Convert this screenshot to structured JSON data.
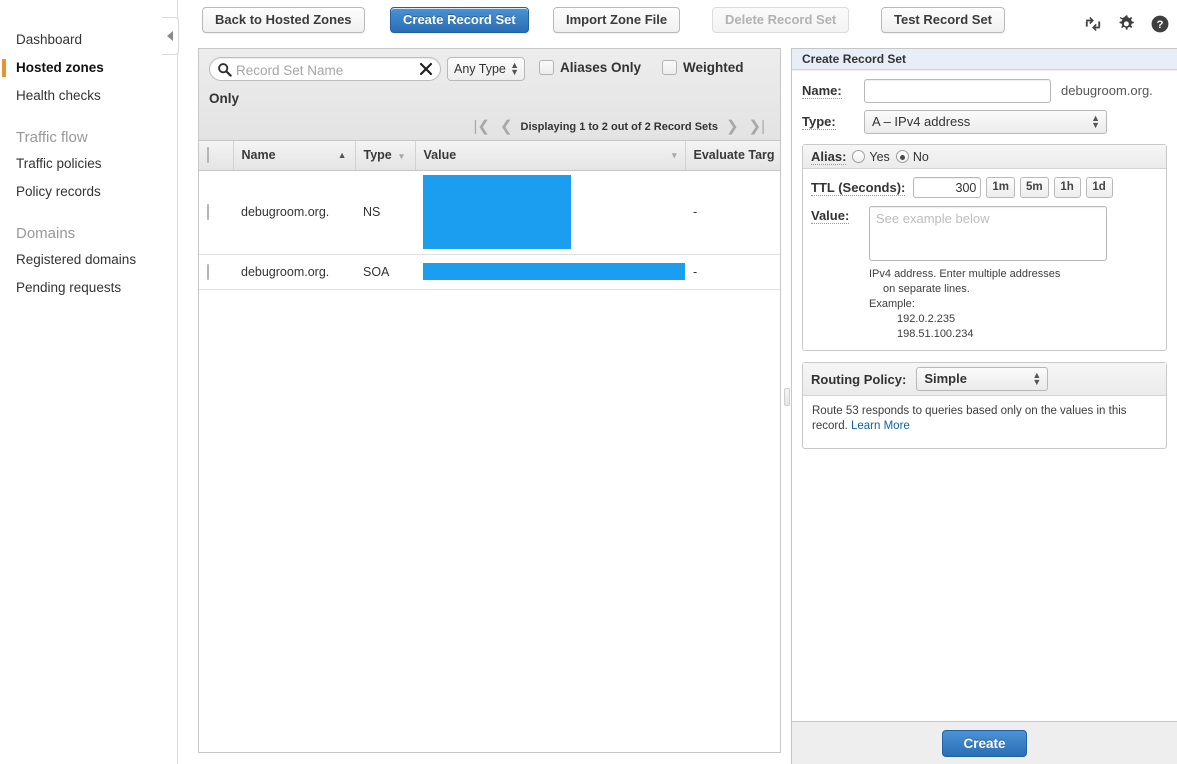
{
  "sidebar": {
    "items": [
      {
        "label": "Dashboard",
        "type": "item",
        "active": false
      },
      {
        "label": "Hosted zones",
        "type": "item",
        "active": true
      },
      {
        "label": "Health checks",
        "type": "item",
        "active": false
      },
      {
        "label": "Traffic flow",
        "type": "group"
      },
      {
        "label": "Traffic policies",
        "type": "item",
        "active": false
      },
      {
        "label": "Policy records",
        "type": "item",
        "active": false
      },
      {
        "label": "Domains",
        "type": "group"
      },
      {
        "label": "Registered domains",
        "type": "item",
        "active": false
      },
      {
        "label": "Pending requests",
        "type": "item",
        "active": false
      }
    ],
    "collapse_icon": "chevron-left-icon",
    "active_marker_color": "#ec912d"
  },
  "toolbar": {
    "back_label": "Back to Hosted Zones",
    "create_record_set_label": "Create Record Set",
    "import_zone_file_label": "Import Zone File",
    "delete_record_set_label": "Delete Record Set",
    "delete_disabled": true,
    "test_record_set_label": "Test Record Set",
    "primary_color": "#2a6eb5",
    "icons": [
      "refresh-icon",
      "gear-icon",
      "help-icon"
    ]
  },
  "filters": {
    "search_placeholder": "Record Set Name",
    "search_value": "",
    "search_icon": "search-icon",
    "clear_icon": "close-icon",
    "type_filter_value": "Any Type",
    "aliases_only_label": "Aliases Only",
    "aliases_only_checked": false,
    "weighted_label": "Weighted",
    "weighted_only_wrap_label": "Only",
    "weighted_checked": false
  },
  "pagination": {
    "first_icon": "first-page-icon",
    "prev_icon": "prev-page-icon",
    "text": "Displaying 1 to 2 out of 2 Record Sets",
    "next_icon": "next-page-icon",
    "last_icon": "last-page-icon"
  },
  "table": {
    "columns": [
      {
        "label": "",
        "key": "check"
      },
      {
        "label": "Name",
        "key": "name",
        "sort": "asc"
      },
      {
        "label": "Type",
        "key": "type",
        "sort": "none"
      },
      {
        "label": "Value",
        "key": "value",
        "sort": "none"
      },
      {
        "label": "Evaluate Targ",
        "key": "evaluate"
      }
    ],
    "rows": [
      {
        "name": "debugroom.org.",
        "type": "NS",
        "value": "",
        "value_redacted": true,
        "evaluate": "-"
      },
      {
        "name": "debugroom.org.",
        "type": "SOA",
        "value": "",
        "value_redacted": true,
        "evaluate": "-"
      }
    ],
    "redaction_color": "#1b9df0"
  },
  "right_panel": {
    "title": "Create Record Set",
    "name_label": "Name:",
    "name_value": "",
    "name_suffix": "debugroom.org.",
    "type_label": "Type:",
    "type_value": "A – IPv4 address",
    "alias_label": "Alias:",
    "alias_yes_label": "Yes",
    "alias_no_label": "No",
    "alias_selected": "No",
    "ttl_label": "TTL (Seconds):",
    "ttl_value": "300",
    "ttl_buttons": [
      "1m",
      "5m",
      "1h",
      "1d"
    ],
    "value_label": "Value:",
    "value_placeholder": "See example below",
    "value_text": "",
    "value_help_line1": "IPv4 address. Enter multiple addresses",
    "value_help_line2": "on separate lines.",
    "value_help_line3": "Example:",
    "value_help_example1": "192.0.2.235",
    "value_help_example2": "198.51.100.234",
    "routing_policy_label": "Routing Policy:",
    "routing_policy_value": "Simple",
    "routing_desc": "Route 53 responds to queries based only on the values in this record.",
    "routing_link": "Learn More",
    "create_label": "Create"
  }
}
